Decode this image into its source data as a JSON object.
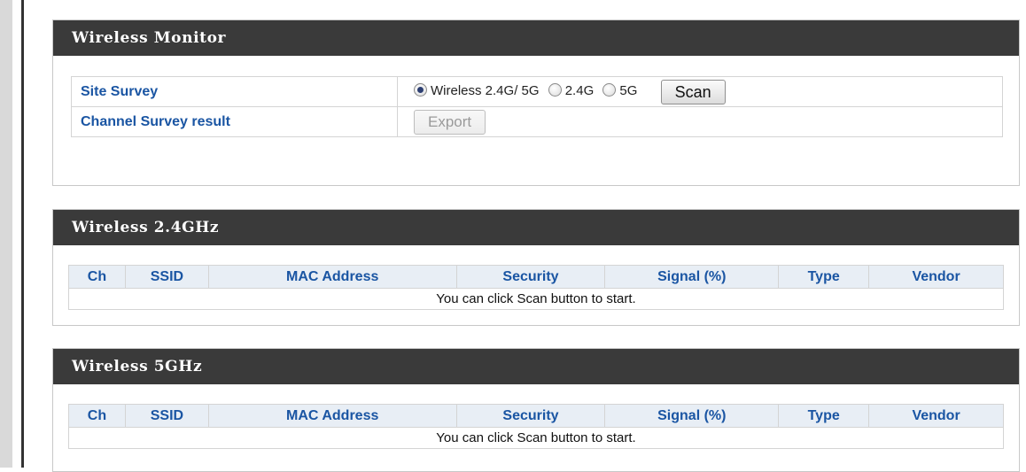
{
  "wireless_monitor": {
    "title": "Wireless Monitor",
    "site_survey_label": "Site Survey",
    "radio_options": [
      {
        "label": "Wireless 2.4G/ 5G",
        "checked": true
      },
      {
        "label": "2.4G",
        "checked": false
      },
      {
        "label": "5G",
        "checked": false
      }
    ],
    "scan_button": "Scan",
    "channel_survey_label": "Channel Survey result",
    "export_button": "Export"
  },
  "wireless_24": {
    "title": "Wireless 2.4GHz",
    "columns": [
      "Ch",
      "SSID",
      "MAC Address",
      "Security",
      "Signal (%)",
      "Type",
      "Vendor"
    ],
    "message": "You can click Scan button to start."
  },
  "wireless_5": {
    "title": "Wireless 5GHz",
    "columns": [
      "Ch",
      "SSID",
      "MAC Address",
      "Security",
      "Signal (%)",
      "Type",
      "Vendor"
    ],
    "message": "You can click Scan button to start."
  },
  "colors": {
    "header_bg": "#3a3a3a",
    "label_blue": "#1a55a3",
    "table_header_bg": "#e8eef5"
  }
}
